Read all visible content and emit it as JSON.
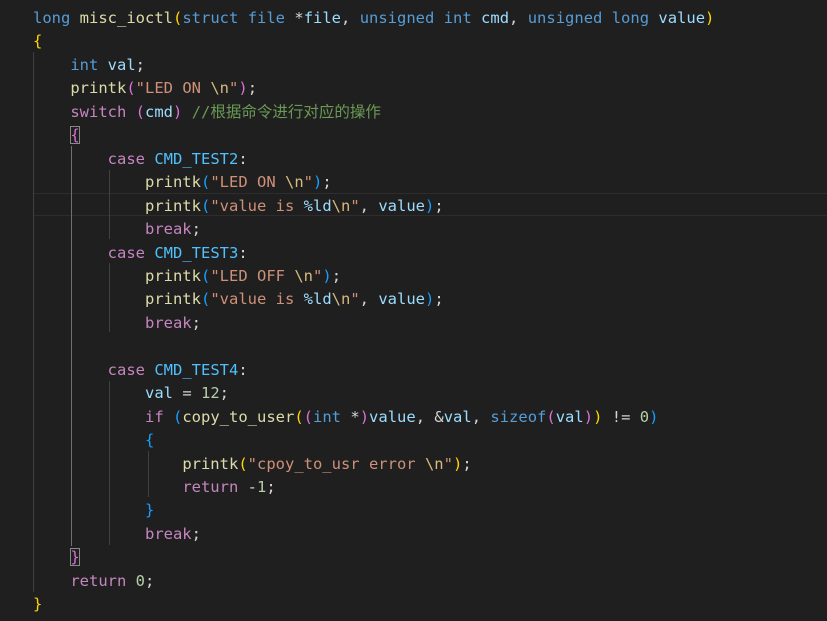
{
  "code": {
    "lines": [
      [
        [
          "kw",
          "long"
        ],
        [
          "plain",
          " "
        ],
        [
          "fn",
          "misc_ioctl"
        ],
        [
          "p1",
          "("
        ],
        [
          "kw",
          "struct"
        ],
        [
          "plain",
          " "
        ],
        [
          "kw",
          "file"
        ],
        [
          "plain",
          " *"
        ],
        [
          "var",
          "file"
        ],
        [
          "plain",
          ", "
        ],
        [
          "kw",
          "unsigned"
        ],
        [
          "plain",
          " "
        ],
        [
          "kw",
          "int"
        ],
        [
          "plain",
          " "
        ],
        [
          "var",
          "cmd"
        ],
        [
          "plain",
          ", "
        ],
        [
          "kw",
          "unsigned"
        ],
        [
          "plain",
          " "
        ],
        [
          "kw",
          "long"
        ],
        [
          "plain",
          " "
        ],
        [
          "var",
          "value"
        ],
        [
          "p1",
          ")"
        ]
      ],
      [
        [
          "p1",
          "{"
        ]
      ],
      [
        [
          "plain",
          "    "
        ],
        [
          "kw",
          "int"
        ],
        [
          "plain",
          " "
        ],
        [
          "var",
          "val"
        ],
        [
          "plain",
          ";"
        ]
      ],
      [
        [
          "plain",
          "    "
        ],
        [
          "fn",
          "printk"
        ],
        [
          "p2",
          "("
        ],
        [
          "str",
          "\"LED ON "
        ],
        [
          "esc",
          "\\n"
        ],
        [
          "str",
          "\""
        ],
        [
          "p2",
          ")"
        ],
        [
          "plain",
          ";"
        ]
      ],
      [
        [
          "plain",
          "    "
        ],
        [
          "ctl",
          "switch"
        ],
        [
          "plain",
          " "
        ],
        [
          "p2",
          "("
        ],
        [
          "var",
          "cmd"
        ],
        [
          "p2",
          ")"
        ],
        [
          "plain",
          " "
        ],
        [
          "com",
          "//根据命令进行对应的操作"
        ]
      ],
      [
        [
          "plain",
          "    "
        ],
        [
          "p2",
          "{",
          "match"
        ]
      ],
      [
        [
          "plain",
          "        "
        ],
        [
          "ctl",
          "case"
        ],
        [
          "plain",
          " "
        ],
        [
          "mac",
          "CMD_TEST2"
        ],
        [
          "plain",
          ":"
        ]
      ],
      [
        [
          "plain",
          "            "
        ],
        [
          "fn",
          "printk"
        ],
        [
          "p3",
          "("
        ],
        [
          "str",
          "\"LED ON "
        ],
        [
          "esc",
          "\\n"
        ],
        [
          "str",
          "\""
        ],
        [
          "p3",
          ")"
        ],
        [
          "plain",
          ";"
        ]
      ],
      [
        [
          "plain",
          "            "
        ],
        [
          "fn",
          "printk"
        ],
        [
          "p3",
          "("
        ],
        [
          "str",
          "\"value is "
        ],
        [
          "var",
          "%ld"
        ],
        [
          "esc",
          "\\n"
        ],
        [
          "str",
          "\""
        ],
        [
          "plain",
          ", "
        ],
        [
          "var",
          "value"
        ],
        [
          "p3",
          ")"
        ],
        [
          "plain",
          ";"
        ]
      ],
      [
        [
          "plain",
          "            "
        ],
        [
          "ctl",
          "break"
        ],
        [
          "plain",
          ";"
        ]
      ],
      [
        [
          "plain",
          "        "
        ],
        [
          "ctl",
          "case"
        ],
        [
          "plain",
          " "
        ],
        [
          "mac",
          "CMD_TEST3"
        ],
        [
          "plain",
          ":"
        ]
      ],
      [
        [
          "plain",
          "            "
        ],
        [
          "fn",
          "printk"
        ],
        [
          "p3",
          "("
        ],
        [
          "str",
          "\"LED OFF "
        ],
        [
          "esc",
          "\\n"
        ],
        [
          "str",
          "\""
        ],
        [
          "p3",
          ")"
        ],
        [
          "plain",
          ";"
        ]
      ],
      [
        [
          "plain",
          "            "
        ],
        [
          "fn",
          "printk"
        ],
        [
          "p3",
          "("
        ],
        [
          "str",
          "\"value is "
        ],
        [
          "var",
          "%ld"
        ],
        [
          "esc",
          "\\n"
        ],
        [
          "str",
          "\""
        ],
        [
          "plain",
          ", "
        ],
        [
          "var",
          "value"
        ],
        [
          "p3",
          ")"
        ],
        [
          "plain",
          ";"
        ]
      ],
      [
        [
          "plain",
          "            "
        ],
        [
          "ctl",
          "break"
        ],
        [
          "plain",
          ";"
        ]
      ],
      [],
      [
        [
          "plain",
          "        "
        ],
        [
          "ctl",
          "case"
        ],
        [
          "plain",
          " "
        ],
        [
          "mac",
          "CMD_TEST4"
        ],
        [
          "plain",
          ":"
        ]
      ],
      [
        [
          "plain",
          "            "
        ],
        [
          "var",
          "val"
        ],
        [
          "plain",
          " = "
        ],
        [
          "num",
          "12"
        ],
        [
          "plain",
          ";"
        ]
      ],
      [
        [
          "plain",
          "            "
        ],
        [
          "ctl",
          "if"
        ],
        [
          "plain",
          " "
        ],
        [
          "p3",
          "("
        ],
        [
          "fn",
          "copy_to_user"
        ],
        [
          "p1",
          "("
        ],
        [
          "p2",
          "("
        ],
        [
          "kw",
          "int"
        ],
        [
          "plain",
          " *"
        ],
        [
          "p2",
          ")"
        ],
        [
          "var",
          "value"
        ],
        [
          "plain",
          ", &"
        ],
        [
          "var",
          "val"
        ],
        [
          "plain",
          ", "
        ],
        [
          "kw",
          "sizeof"
        ],
        [
          "p2",
          "("
        ],
        [
          "var",
          "val"
        ],
        [
          "p2",
          ")"
        ],
        [
          "p1",
          ")"
        ],
        [
          "plain",
          " != "
        ],
        [
          "num",
          "0"
        ],
        [
          "p3",
          ")"
        ]
      ],
      [
        [
          "plain",
          "            "
        ],
        [
          "p3",
          "{"
        ]
      ],
      [
        [
          "plain",
          "                "
        ],
        [
          "fn",
          "printk"
        ],
        [
          "p1",
          "("
        ],
        [
          "str",
          "\"cpoy_to_usr error "
        ],
        [
          "esc",
          "\\n"
        ],
        [
          "str",
          "\""
        ],
        [
          "p1",
          ")"
        ],
        [
          "plain",
          ";"
        ]
      ],
      [
        [
          "plain",
          "                "
        ],
        [
          "ctl",
          "return"
        ],
        [
          "plain",
          " -"
        ],
        [
          "num",
          "1"
        ],
        [
          "plain",
          ";"
        ]
      ],
      [
        [
          "plain",
          "            "
        ],
        [
          "p3",
          "}"
        ]
      ],
      [
        [
          "plain",
          "            "
        ],
        [
          "ctl",
          "break"
        ],
        [
          "plain",
          ";"
        ]
      ],
      [
        [
          "plain",
          "    "
        ],
        [
          "p2",
          "}",
          "match"
        ]
      ],
      [
        [
          "plain",
          "    "
        ],
        [
          "ctl",
          "return"
        ],
        [
          "plain",
          " "
        ],
        [
          "num",
          "0"
        ],
        [
          "plain",
          ";"
        ]
      ],
      [
        [
          "p1",
          "}"
        ]
      ]
    ]
  }
}
